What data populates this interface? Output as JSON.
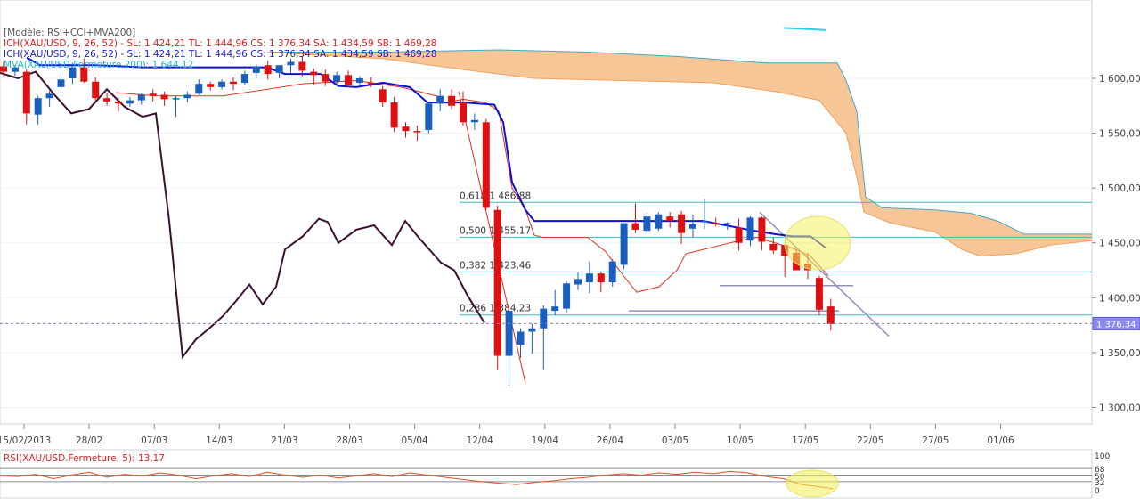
{
  "header": {
    "model_label": "[Modèle: RSI+CCI+MVA200]",
    "ich_line_red": "ICH(XAU/USD, 9, 26, 52) -  SL: 1 424,21  TL: 1 444,96  CS: 1 376,34  SA: 1 434,59  SB: 1 469,28",
    "ich_line_blue": "ICH(XAU/USD, 9, 26, 52) -  SL: 1 424,21  TL: 1 444,96  CS: 1 376,34  SA: 1 434,59  SB: 1 469,28",
    "mva_line": "MVA(XAU/USD.Fermeture,200): 1 644,12"
  },
  "price_axis": {
    "labels": [
      "1 600,00",
      "1 550,00",
      "1 500,00",
      "1 450,00",
      "1 400,00",
      "1 350,00",
      "1 300,00"
    ],
    "values": [
      1600,
      1550,
      1500,
      1450,
      1400,
      1350,
      1300
    ],
    "current_price_label": "1 376,34",
    "current_price": 1376.34
  },
  "date_axis": {
    "labels": [
      "15/02/2013",
      "28/02",
      "07/03",
      "14/03",
      "21/03",
      "28/03",
      "05/04",
      "12/04",
      "19/04",
      "26/04",
      "03/05",
      "10/05",
      "17/05",
      "22/05",
      "27/05",
      "01/06"
    ]
  },
  "fibonacci": [
    {
      "label": "0,618 1 486,88",
      "value": 1486.88
    },
    {
      "label": "0,500 1 455,17",
      "value": 1455.17
    },
    {
      "label": "0,382 1 423,46",
      "value": 1423.46
    },
    {
      "label": "0,236 1 384,23",
      "value": 1384.23
    }
  ],
  "rsi_panel": {
    "label": "RSI(XAU/USD.Fermeture, 5): 13,17",
    "axis_labels": [
      "100",
      "68",
      "50",
      "32",
      "0"
    ],
    "levels": [
      100,
      68,
      50,
      32,
      0
    ]
  },
  "colors": {
    "bull": "#1a5fc0",
    "bear": "#dd1111",
    "kijun": "#1010d0",
    "tenkan": "#e03020",
    "chikou": "#3a1030",
    "cloud_fill": "#f6c08c",
    "span_b": "#40a8c8",
    "fib": "#40b8c0",
    "current_price_box": "#8c8cf0",
    "highlight": "#f4f060"
  },
  "chart_data": {
    "type": "candlestick",
    "instrument": "XAU/USD",
    "ylim": [
      1290,
      1650
    ],
    "dates": [
      "15/02/2013",
      "28/02",
      "07/03",
      "14/03",
      "21/03",
      "28/03",
      "05/04",
      "12/04",
      "19/04",
      "26/04",
      "03/05",
      "10/05",
      "17/05",
      "22/05",
      "27/05",
      "01/06"
    ],
    "candles": [
      [
        1611,
        1615,
        1602,
        1606
      ],
      [
        1606,
        1612,
        1602,
        1610
      ],
      [
        1606,
        1608,
        1558,
        1568
      ],
      [
        1567,
        1584,
        1558,
        1582
      ],
      [
        1582,
        1590,
        1574,
        1586
      ],
      [
        1592,
        1602,
        1589,
        1599
      ],
      [
        1600,
        1614,
        1595,
        1610
      ],
      [
        1610,
        1618,
        1596,
        1597
      ],
      [
        1597,
        1601,
        1580,
        1582
      ],
      [
        1582,
        1587,
        1575,
        1579
      ],
      [
        1579,
        1582,
        1570,
        1577
      ],
      [
        1577,
        1583,
        1574,
        1580
      ],
      [
        1580,
        1587,
        1576,
        1585
      ],
      [
        1586,
        1590,
        1579,
        1584
      ],
      [
        1585,
        1588,
        1575,
        1581
      ],
      [
        1581,
        1584,
        1565,
        1582
      ],
      [
        1582,
        1588,
        1578,
        1585
      ],
      [
        1586,
        1599,
        1585,
        1595
      ],
      [
        1595,
        1597,
        1589,
        1592
      ],
      [
        1592,
        1599,
        1590,
        1597
      ],
      [
        1597,
        1601,
        1589,
        1595
      ],
      [
        1596,
        1607,
        1594,
        1604
      ],
      [
        1605,
        1613,
        1600,
        1611
      ],
      [
        1612,
        1616,
        1599,
        1604
      ],
      [
        1605,
        1610,
        1600,
        1612
      ],
      [
        1612,
        1618,
        1605,
        1615
      ],
      [
        1615,
        1620,
        1602,
        1607
      ],
      [
        1606,
        1609,
        1594,
        1603
      ],
      [
        1604,
        1608,
        1593,
        1597
      ],
      [
        1597,
        1606,
        1593,
        1603
      ],
      [
        1603,
        1607,
        1592,
        1594
      ],
      [
        1596,
        1602,
        1594,
        1600
      ],
      [
        1596,
        1601,
        1592,
        1595
      ],
      [
        1590,
        1593,
        1574,
        1578
      ],
      [
        1578,
        1583,
        1551,
        1555
      ],
      [
        1556,
        1560,
        1546,
        1552
      ],
      [
        1552,
        1557,
        1543,
        1551
      ],
      [
        1553,
        1579,
        1550,
        1577
      ],
      [
        1577,
        1590,
        1570,
        1584
      ],
      [
        1584,
        1590,
        1572,
        1575
      ],
      [
        1578,
        1588,
        1557,
        1560
      ],
      [
        1560,
        1568,
        1553,
        1562
      ],
      [
        1560,
        1563,
        1480,
        1482
      ],
      [
        1480,
        1484,
        1334,
        1347
      ],
      [
        1347,
        1388,
        1320,
        1388
      ],
      [
        1357,
        1372,
        1345,
        1369
      ],
      [
        1369,
        1376,
        1349,
        1372
      ],
      [
        1372,
        1393,
        1334,
        1390
      ],
      [
        1388,
        1407,
        1384,
        1392
      ],
      [
        1390,
        1415,
        1386,
        1413
      ],
      [
        1412,
        1423,
        1407,
        1417
      ],
      [
        1414,
        1433,
        1404,
        1422
      ],
      [
        1422,
        1424,
        1405,
        1414
      ],
      [
        1414,
        1435,
        1410,
        1433
      ],
      [
        1430,
        1468,
        1426,
        1468
      ],
      [
        1468,
        1486,
        1459,
        1462
      ],
      [
        1461,
        1477,
        1457,
        1474
      ],
      [
        1463,
        1478,
        1461,
        1476
      ],
      [
        1474,
        1478,
        1464,
        1470
      ],
      [
        1476,
        1479,
        1449,
        1459
      ],
      [
        1463,
        1476,
        1455,
        1467
      ],
      [
        1470,
        1490,
        1463,
        1470
      ],
      [
        1468,
        1473,
        1465,
        1467
      ],
      [
        1467,
        1469,
        1462,
        1468
      ],
      [
        1464,
        1472,
        1443,
        1450
      ],
      [
        1452,
        1474,
        1447,
        1473
      ],
      [
        1473,
        1474,
        1443,
        1451
      ],
      [
        1449,
        1455,
        1440,
        1443
      ],
      [
        1448,
        1451,
        1419,
        1438
      ],
      [
        1441,
        1446,
        1425,
        1425
      ],
      [
        1431,
        1441,
        1417,
        1425
      ],
      [
        1418,
        1420,
        1384,
        1389
      ],
      [
        1392,
        1399,
        1370,
        1376
      ]
    ],
    "rsi_levels": [
      68,
      50,
      32
    ],
    "rsi_last": 13.17
  }
}
